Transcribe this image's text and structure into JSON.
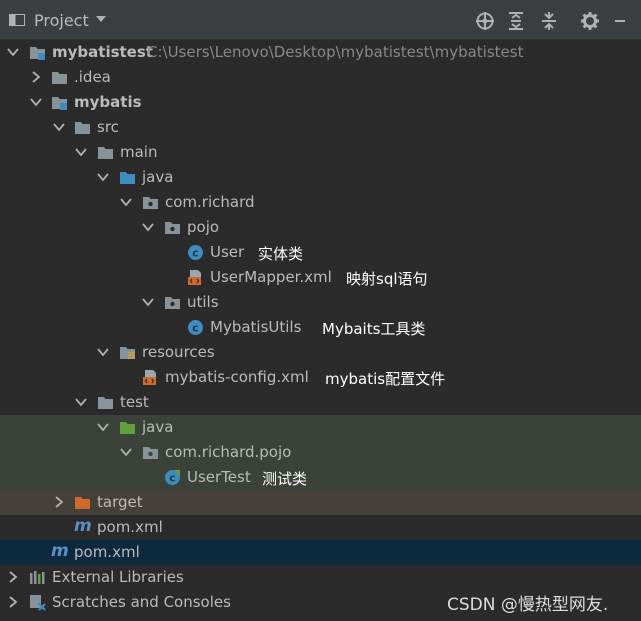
{
  "toolbar": {
    "title": "Project"
  },
  "tree": {
    "root": {
      "name": "mybatistest",
      "path": "C:\\Users\\Lenovo\\Desktop\\mybatistest\\mybatistest"
    },
    "idea": ".idea",
    "mybatis": "mybatis",
    "src": "src",
    "main": "main",
    "java_main": "java",
    "pkg_main": "com.richard",
    "pojo": "pojo",
    "user": {
      "name": "User",
      "note": "实体类"
    },
    "usermapper": {
      "name": "UserMapper.xml",
      "note": "映射sql语句"
    },
    "utils": "utils",
    "mybatisutils": {
      "name": "MybatisUtils",
      "note": "Mybaits工具类"
    },
    "resources": "resources",
    "config": {
      "name": "mybatis-config.xml",
      "note": "mybatis配置文件"
    },
    "test": "test",
    "java_test": "java",
    "pkg_test": "com.richard.pojo",
    "usertest": {
      "name": "UserTest",
      "note": "测试类"
    },
    "target": "target",
    "pom_inner": "pom.xml",
    "pom_outer": "pom.xml",
    "ext_libs": "External Libraries",
    "scratches": "Scratches and Consoles"
  },
  "watermark": "CSDN @慢热型网友.",
  "colors": {
    "background": "#2b2b2b",
    "selection": "#0d293e",
    "test_highlight": "#3b4239",
    "excluded_highlight": "#45413a",
    "folder": "#87939a",
    "source_folder": "#3d8dbf",
    "test_folder": "#62a03e",
    "excluded_folder": "#d0692c"
  }
}
